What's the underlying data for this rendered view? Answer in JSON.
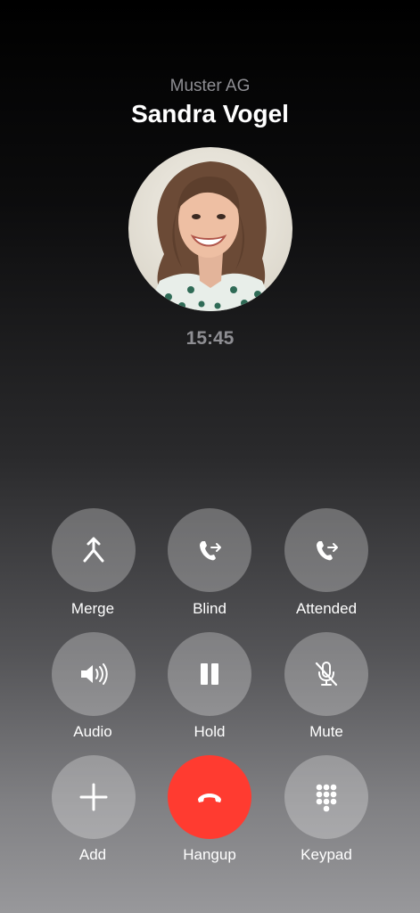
{
  "caller": {
    "company": "Muster AG",
    "name": "Sandra Vogel",
    "duration": "15:45",
    "avatar_alt": "Sandra Vogel"
  },
  "actions": {
    "merge": {
      "label": "Merge",
      "icon": "merge-icon"
    },
    "blind": {
      "label": "Blind",
      "icon": "phone-forward-icon"
    },
    "attended": {
      "label": "Attended",
      "icon": "phone-forward-icon"
    },
    "audio": {
      "label": "Audio",
      "icon": "speaker-icon"
    },
    "hold": {
      "label": "Hold",
      "icon": "pause-icon"
    },
    "mute": {
      "label": "Mute",
      "icon": "mic-off-icon"
    },
    "add": {
      "label": "Add",
      "icon": "plus-icon"
    },
    "hangup": {
      "label": "Hangup",
      "icon": "end-call-icon"
    },
    "keypad": {
      "label": "Keypad",
      "icon": "keypad-icon"
    }
  },
  "colors": {
    "hangup": "#ff3b30",
    "button_bg": "rgba(255,255,255,0.28)",
    "secondary_text": "#8e8e93"
  }
}
